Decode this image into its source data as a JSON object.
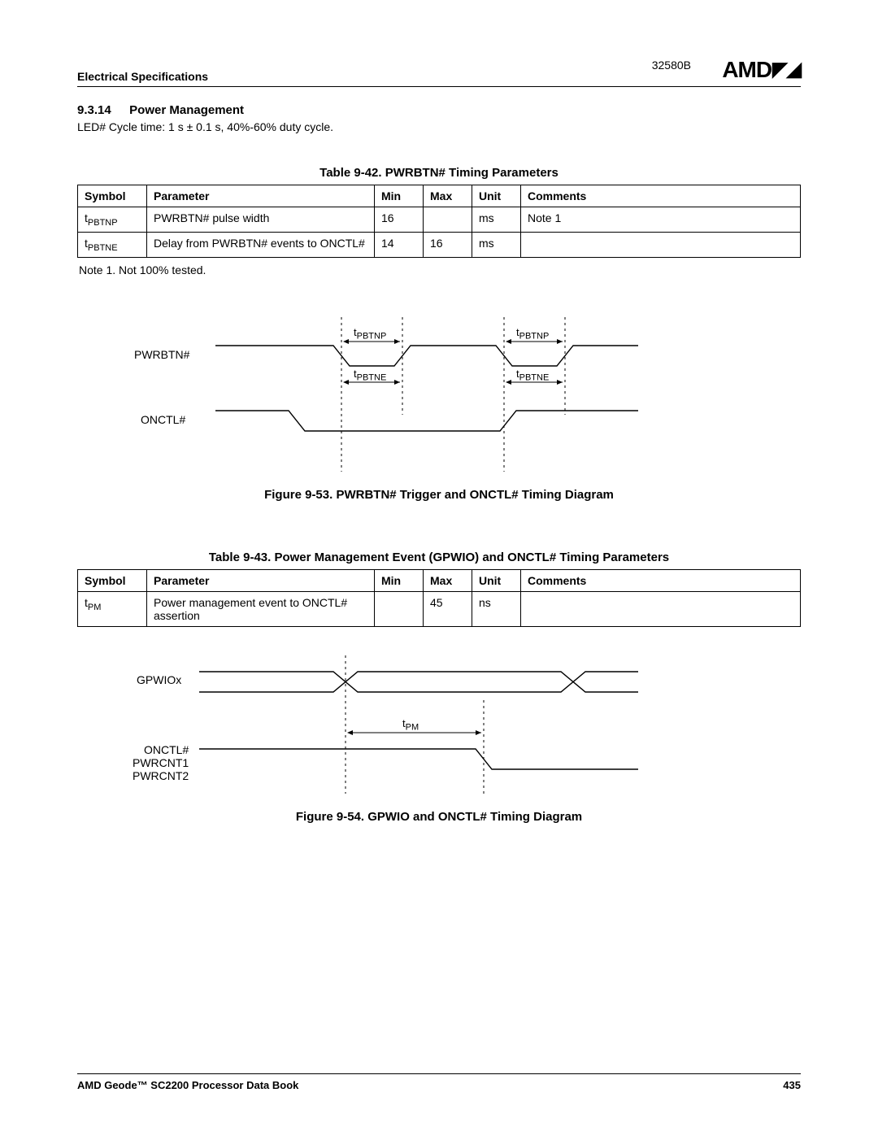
{
  "header": {
    "left": "Electrical Specifications",
    "docnum": "32580B",
    "logo": "AMD"
  },
  "section": {
    "number": "9.3.14",
    "title": "Power Management",
    "led_line": "LED# Cycle time: 1 s ± 0.1 s, 40%-60% duty cycle."
  },
  "table1": {
    "caption": "Table 9-42.  PWRBTN# Timing Parameters",
    "headers": {
      "symbol": "Symbol",
      "parameter": "Parameter",
      "min": "Min",
      "max": "Max",
      "unit": "Unit",
      "comments": "Comments"
    },
    "rows": [
      {
        "symbol_pre": "t",
        "symbol_sub": "PBTNP",
        "parameter": "PWRBTN# pulse width",
        "min": "16",
        "max": "",
        "unit": "ms",
        "comments": "Note 1"
      },
      {
        "symbol_pre": "t",
        "symbol_sub": "PBTNE",
        "parameter": "Delay from PWRBTN# events to ONCTL#",
        "min": "14",
        "max": "16",
        "unit": "ms",
        "comments": ""
      }
    ],
    "note": "Note 1.   Not 100% tested."
  },
  "figure1": {
    "caption": "Figure 9-53.  PWRBTN# Trigger and ONCTL# Timing Diagram",
    "signals": {
      "a": "PWRBTN#",
      "b": "ONCTL#"
    },
    "labels": {
      "tpbtnp_pre": "t",
      "tpbtnp_sub": "PBTNP",
      "tpbtne_pre": "t",
      "tpbtne_sub": "PBTNE"
    }
  },
  "table2": {
    "caption": "Table 9-43.  Power Management Event (GPWIO) and ONCTL# Timing Parameters",
    "headers": {
      "symbol": "Symbol",
      "parameter": "Parameter",
      "min": "Min",
      "max": "Max",
      "unit": "Unit",
      "comments": "Comments"
    },
    "rows": [
      {
        "symbol_pre": "t",
        "symbol_sub": "PM",
        "parameter": "Power management event to ONCTL# assertion",
        "min": "",
        "max": "45",
        "unit": "ns",
        "comments": ""
      }
    ]
  },
  "figure2": {
    "caption": "Figure 9-54.  GPWIO and ONCTL# Timing Diagram",
    "signals": {
      "a": "GPWIOx",
      "b1": "ONCTL#",
      "b2": "PWRCNT1",
      "b3": "PWRCNT2"
    },
    "labels": {
      "tpm_pre": "t",
      "tpm_sub": "PM"
    }
  },
  "footer": {
    "left": "AMD Geode™ SC2200  Processor Data Book",
    "right": "435"
  }
}
